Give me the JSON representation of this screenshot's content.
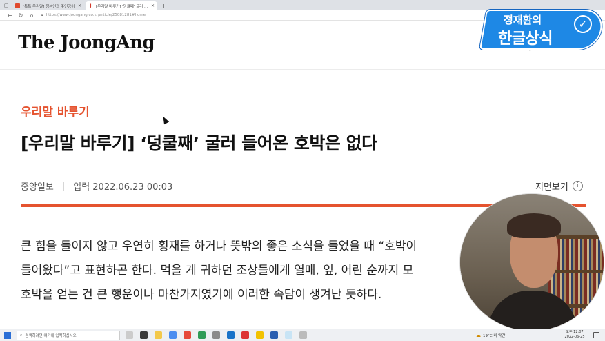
{
  "browser": {
    "tabs": [
      {
        "title": "[톡톡 우리말] 정본인과 주인공이",
        "active": false,
        "favicon": "red-square"
      },
      {
        "title": "[우리말 바루기] '덩쿨째' 굴러 ...",
        "active": true,
        "favicon": "joongang-j"
      }
    ],
    "new_tab": "+",
    "url": "https://www.joongang.co.kr/article/25081281#home"
  },
  "site": {
    "logo": "The JoongAng"
  },
  "overlay": {
    "name": "정재환의",
    "program": "한글상식",
    "check": "✓"
  },
  "article": {
    "section": "우리말 바루기",
    "headline": "[우리말 바루기] ‘덩쿨째’ 굴러 들어온 호박은 없다",
    "publisher": "중앙일보",
    "date_label": "입력 2022.06.23 00:03",
    "print_label": "지면보기",
    "info": "i",
    "body_lines": [
      "큰 힘을 들이지 않고 우연히 횡재를 하거나 뜻밖의 좋은 소식을 들었을 때 “호박이",
      "들어왔다”고 표현하곤 한다. 먹을 게 귀하던 조상들에게 열매, 잎, 어린 순까지 모",
      "호박을 얻는 건 큰 행운이나 마찬가지였기에 이러한 속담이 생겨난 듯하다."
    ]
  },
  "taskbar": {
    "search_placeholder": "검색하려면 여기에 입력하십시오",
    "weather": "19°C 비 약간",
    "time": "오후 12:07",
    "date": "2022-06-25"
  },
  "colors": {
    "accent": "#e5532f",
    "badge": "#1e88e5"
  }
}
